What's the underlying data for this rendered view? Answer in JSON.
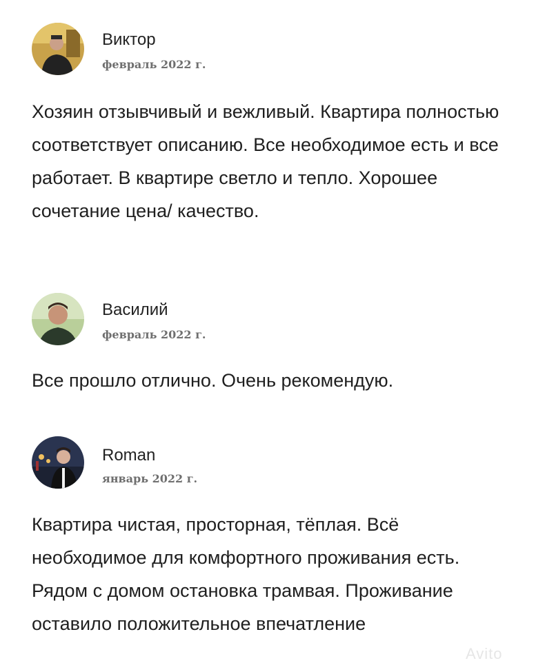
{
  "reviews": [
    {
      "name": "Виктор",
      "date": "февраль 2022 г.",
      "avatar_icon": "person-photo-icon",
      "text": "Хозяин отзывчивый и вежливый. Квартира полностью соответствует описанию. Все необходимое есть и все работает. В квартире светло и тепло. Хорошее сочетание цена/ качество."
    },
    {
      "name": "Василий",
      "date": "февраль 2022 г.",
      "avatar_icon": "person-photo-icon",
      "text": "Все прошло отлично. Очень рекомендую."
    },
    {
      "name": "Roman",
      "date": "январь 2022 г.",
      "avatar_icon": "person-photo-icon",
      "text": "Квартира чистая, просторная, тёплая. Всё необходимое для комфортного проживания есть. Рядом с домом остановка трамвая. Проживание оставило положительное впечатление"
    }
  ],
  "watermark": "Avito"
}
